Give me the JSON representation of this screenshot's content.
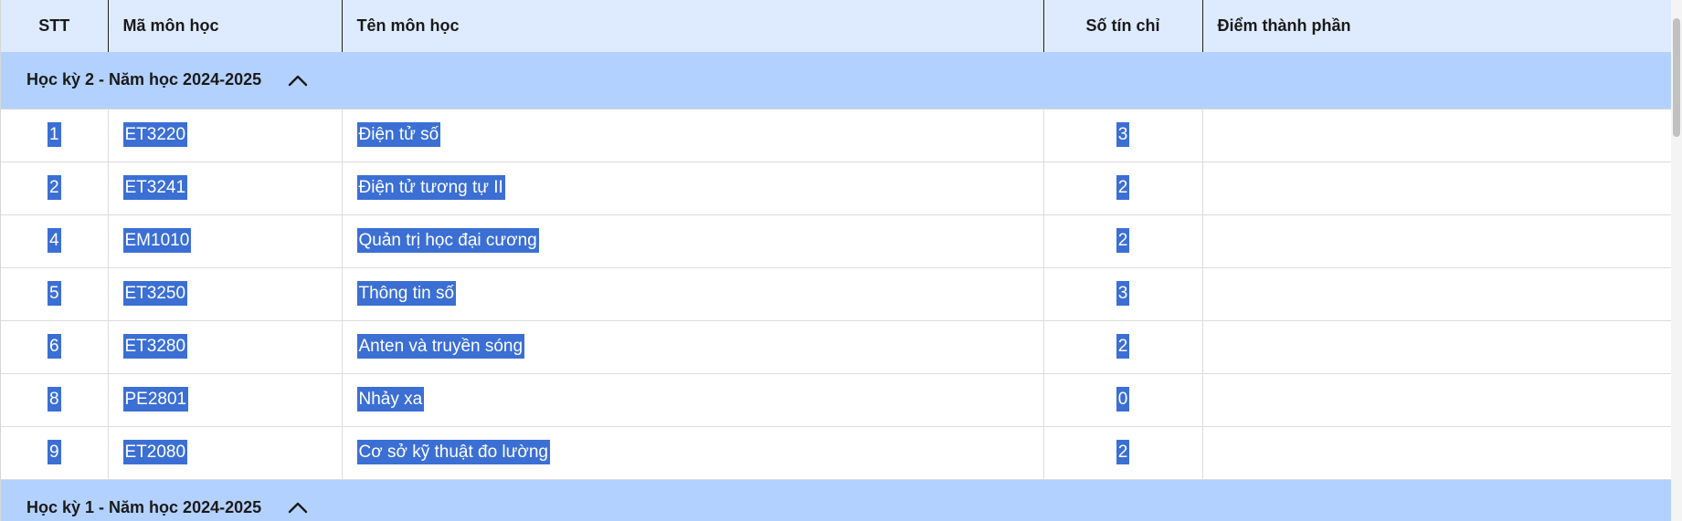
{
  "table": {
    "headers": {
      "stt": "STT",
      "code": "Mã môn học",
      "name": "Tên môn học",
      "credits": "Số tín chỉ",
      "score": "Điểm thành phần"
    },
    "groups": [
      {
        "label": "Học kỳ 2 - Năm học 2024-2025",
        "expand_icon": "chevron-up-icon",
        "rows": [
          {
            "stt": "1",
            "code": "ET3220",
            "name": "Điện tử số",
            "credits": "3",
            "score": ""
          },
          {
            "stt": "2",
            "code": "ET3241",
            "name": "Điện tử tương tự II",
            "credits": "2",
            "score": ""
          },
          {
            "stt": "4",
            "code": "EM1010",
            "name": "Quản trị học đại cương",
            "credits": "2",
            "score": ""
          },
          {
            "stt": "5",
            "code": "ET3250",
            "name": "Thông tin số",
            "credits": "3",
            "score": ""
          },
          {
            "stt": "6",
            "code": "ET3280",
            "name": "Anten và truyền sóng",
            "credits": "2",
            "score": ""
          },
          {
            "stt": "8",
            "code": "PE2801",
            "name": "Nhảy xa",
            "credits": "0",
            "score": ""
          },
          {
            "stt": "9",
            "code": "ET2080",
            "name": "Cơ sở kỹ thuật đo lường",
            "credits": "2",
            "score": ""
          }
        ]
      },
      {
        "label": "Học kỳ 1 - Năm học 2024-2025",
        "expand_icon": "chevron-up-icon",
        "rows": []
      }
    ]
  },
  "colors": {
    "header_bg": "#deebff",
    "group_bg": "#b3d1ff",
    "selection_bg": "#3b6fd4",
    "selection_text": "#ffffff"
  }
}
